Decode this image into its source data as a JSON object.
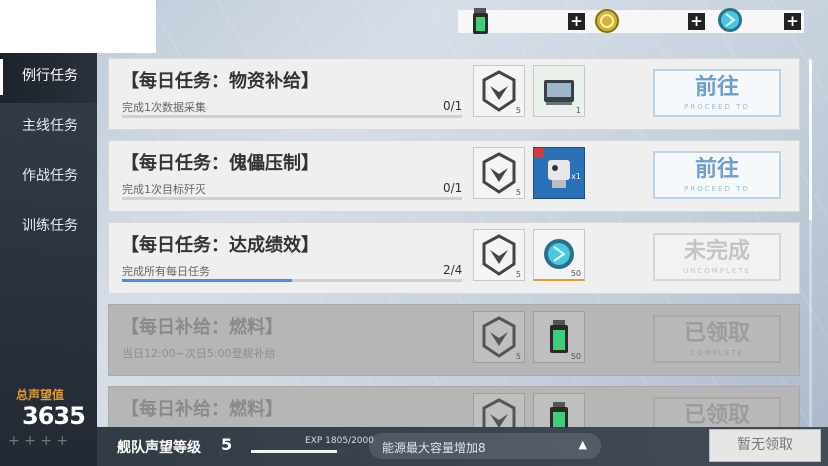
{
  "currency": {
    "items": [
      {
        "icon": "fuel-canister-icon",
        "color": "#3ecf7a"
      },
      {
        "icon": "gold-coin-icon",
        "color": "#d6b238"
      },
      {
        "icon": "energy-core-icon",
        "color": "#46c8e0"
      }
    ],
    "plus_label": "+"
  },
  "sidebar": {
    "items": [
      {
        "label": "例行任务",
        "active": true
      },
      {
        "label": "主线任务",
        "active": false
      },
      {
        "label": "作战任务",
        "active": false
      },
      {
        "label": "训练任务",
        "active": false
      }
    ],
    "reputation_label": "总声望值",
    "reputation_value": "3635"
  },
  "tasks": [
    {
      "title": "【每日任务：物资补给】",
      "desc": "完成1次数据采集",
      "progress": "0/1",
      "progress_fraction": 0,
      "rewards": [
        {
          "icon": "reputation-emblem-icon",
          "qty": "5"
        },
        {
          "icon": "data-terminal-icon",
          "qty": "1"
        }
      ],
      "action_main": "前往",
      "action_sub": "PROCEED TO",
      "state": "proceed"
    },
    {
      "title": "【每日任务：傀儡压制】",
      "desc": "完成1次目标歼灭",
      "progress": "0/1",
      "progress_fraction": 0,
      "rewards": [
        {
          "icon": "reputation-emblem-icon",
          "qty": "5"
        },
        {
          "icon": "mech-unit-card-icon",
          "qty": "x1"
        }
      ],
      "action_main": "前往",
      "action_sub": "PROCEED TO",
      "state": "proceed"
    },
    {
      "title": "【每日任务：达成绩效】",
      "desc": "完成所有每日任务",
      "progress": "2/4",
      "progress_fraction": 0.5,
      "rewards": [
        {
          "icon": "reputation-emblem-icon",
          "qty": "5"
        },
        {
          "icon": "energy-core-icon",
          "qty": "50"
        }
      ],
      "action_main": "未完成",
      "action_sub": "UNCOMPLETE",
      "state": "incomplete"
    },
    {
      "title": "【每日补给：燃料】",
      "desc": "当日12:00~次日5:00登舰补给",
      "progress": "",
      "progress_fraction": 0,
      "rewards": [
        {
          "icon": "reputation-emblem-icon",
          "qty": "5"
        },
        {
          "icon": "fuel-canister-icon",
          "qty": "50"
        }
      ],
      "action_main": "已领取",
      "action_sub": "COMPLETE",
      "state": "claimed"
    },
    {
      "title": "【每日补给：燃料】",
      "desc": "",
      "progress": "",
      "progress_fraction": 0,
      "rewards": [
        {
          "icon": "reputation-emblem-icon",
          "qty": ""
        },
        {
          "icon": "fuel-canister-icon",
          "qty": ""
        }
      ],
      "action_main": "已领取",
      "action_sub": "",
      "state": "claimed"
    }
  ],
  "bottom": {
    "fleet_label": "舰队声望等级",
    "fleet_level": "5",
    "exp_text": "EXP 1805/2000",
    "exp_fraction": 0.9025,
    "energy_text": "能源最大容量增加8",
    "energy_arrow": "▲",
    "claim_label": "暂无领取"
  }
}
